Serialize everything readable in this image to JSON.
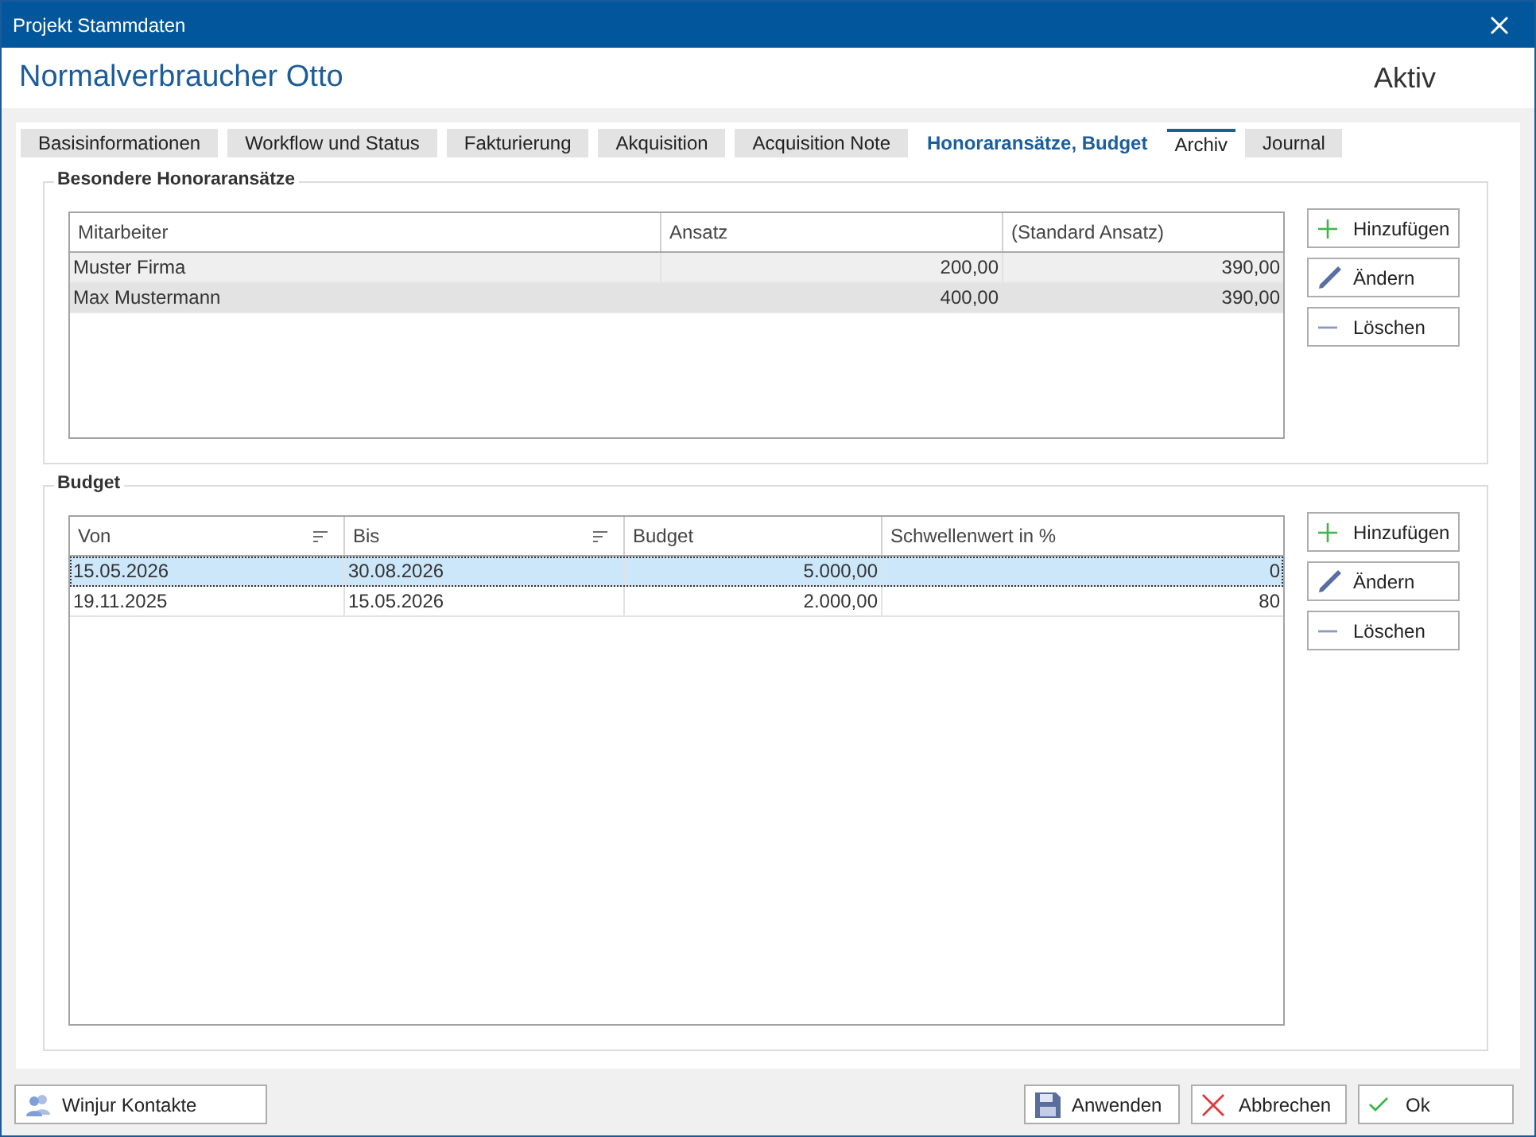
{
  "window": {
    "title": "Projekt Stammdaten"
  },
  "header": {
    "name": "Normalverbraucher Otto",
    "status": "Aktiv"
  },
  "tabs": [
    {
      "label": "Basisinformationen",
      "selected": false,
      "hovered": false
    },
    {
      "label": "Workflow und Status",
      "selected": false,
      "hovered": false
    },
    {
      "label": "Fakturierung",
      "selected": false,
      "hovered": false
    },
    {
      "label": "Akquisition",
      "selected": false,
      "hovered": false
    },
    {
      "label": "Acquisition Note",
      "selected": false,
      "hovered": false
    },
    {
      "label": "Honoraransätze, Budget",
      "selected": true,
      "hovered": false
    },
    {
      "label": "Archiv",
      "selected": false,
      "hovered": true
    },
    {
      "label": "Journal",
      "selected": false,
      "hovered": false
    }
  ],
  "sections": [
    {
      "title": "Besondere Honoraransätze",
      "table": {
        "focused": false,
        "columns": [
          {
            "label": "Mitarbeiter",
            "kind": "text",
            "sort_icon": false
          },
          {
            "label": "Ansatz",
            "kind": "number",
            "sort_icon": false
          },
          {
            "label": "(Standard Ansatz)",
            "kind": "number",
            "sort_icon": false
          }
        ],
        "rows": [
          {
            "selected": false,
            "cells": [
              "Muster Firma",
              "200,00",
              "390,00"
            ]
          },
          {
            "selected": true,
            "cells": [
              "Max Mustermann",
              "400,00",
              "390,00"
            ]
          }
        ]
      },
      "buttons": [
        {
          "label": "Hinzufügen",
          "kind": "add"
        },
        {
          "label": "Ändern",
          "kind": "edit"
        },
        {
          "label": "Löschen",
          "kind": "delete"
        }
      ]
    },
    {
      "title": "Budget",
      "table": {
        "focused": true,
        "columns": [
          {
            "label": "Von",
            "kind": "text",
            "sort_icon": true
          },
          {
            "label": "Bis",
            "kind": "text",
            "sort_icon": true
          },
          {
            "label": "Budget",
            "kind": "number",
            "sort_icon": false
          },
          {
            "label": "Schwellenwert in %",
            "kind": "number",
            "sort_icon": false
          }
        ],
        "rows": [
          {
            "selected": true,
            "cells": [
              "15.05.2026",
              "30.08.2026",
              "5.000,00",
              "0"
            ]
          },
          {
            "selected": false,
            "cells": [
              "19.11.2025",
              "15.05.2026",
              "2.000,00",
              "80"
            ]
          }
        ]
      },
      "buttons": [
        {
          "label": "Hinzufügen",
          "kind": "add"
        },
        {
          "label": "Ändern",
          "kind": "edit"
        },
        {
          "label": "Löschen",
          "kind": "delete"
        }
      ]
    }
  ],
  "footer": {
    "left_buttons": [
      {
        "label": "Winjur Kontakte",
        "kind": "contacts"
      }
    ],
    "right_buttons": [
      {
        "label": "Anwenden",
        "kind": "save"
      },
      {
        "label": "Abbrechen",
        "kind": "cancel"
      },
      {
        "label": "Ok",
        "kind": "ok"
      }
    ]
  }
}
